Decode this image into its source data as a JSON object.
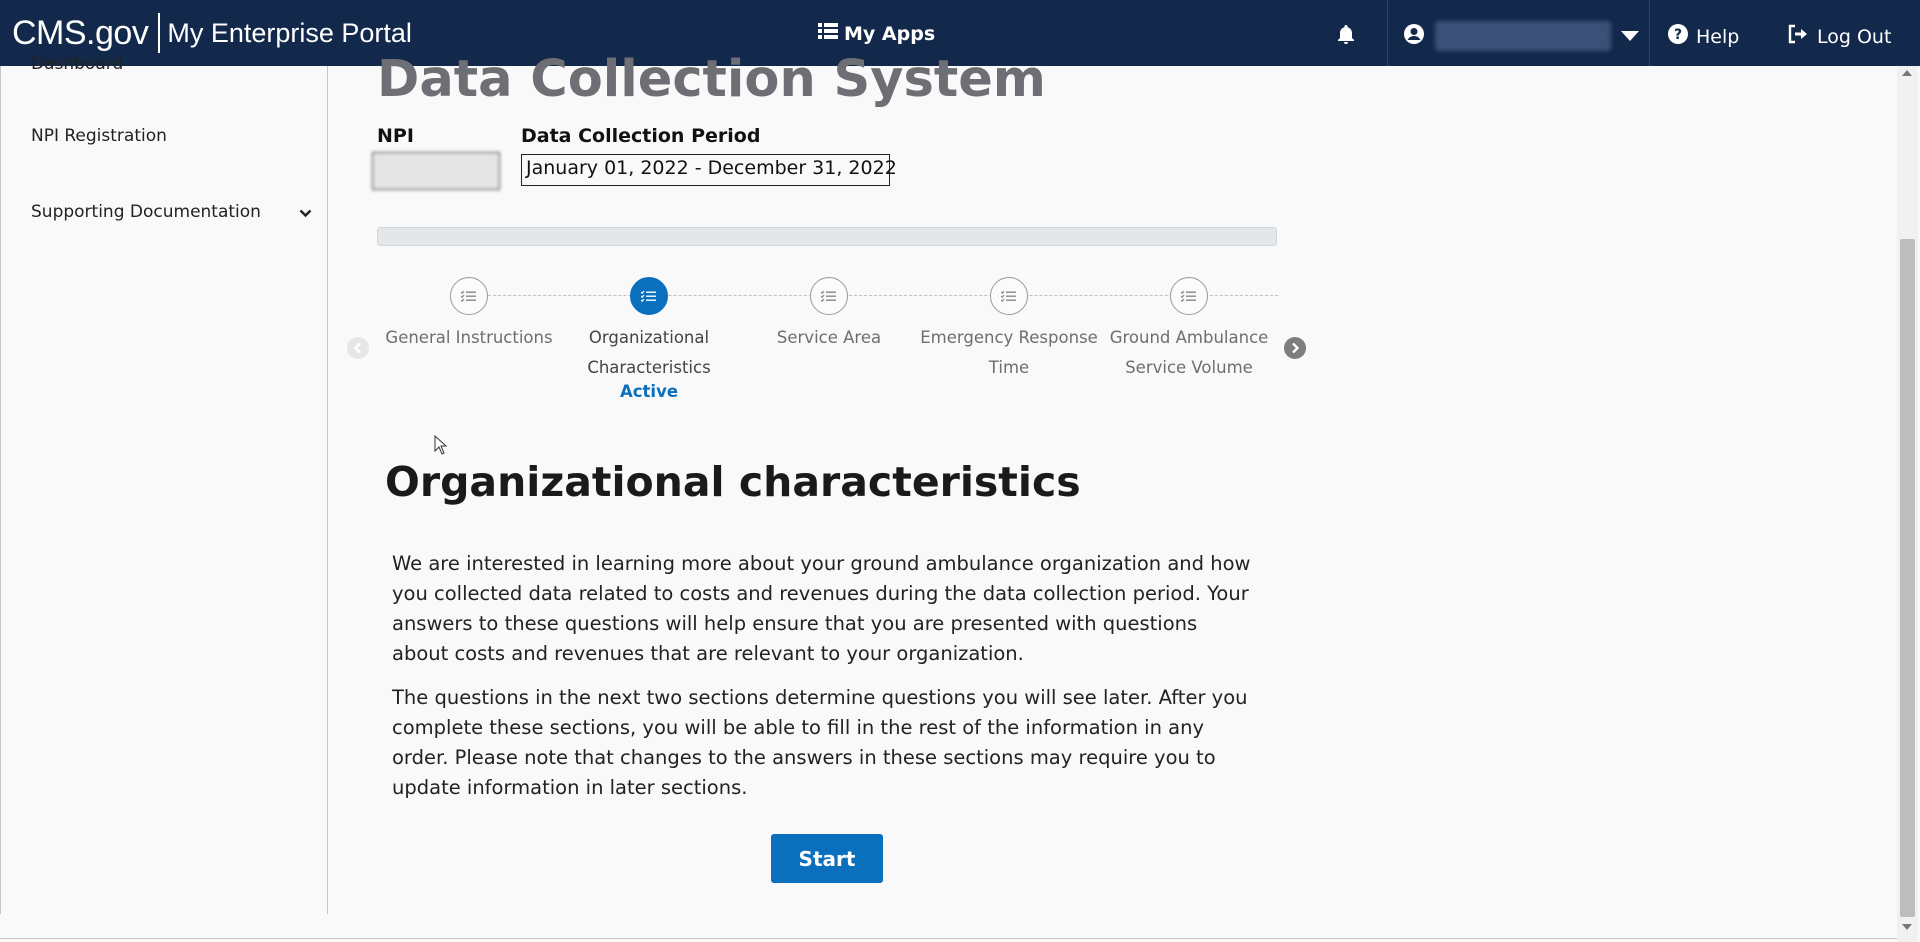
{
  "header": {
    "logo_cms": "CMS.gov",
    "logo_portal": "My Enterprise Portal",
    "my_apps_label": "My Apps",
    "help_label": "Help",
    "logout_label": "Log Out"
  },
  "sidebar": {
    "items": [
      {
        "label": "Dashboard"
      },
      {
        "label": "NPI Registration"
      },
      {
        "label": "Supporting Documentation"
      }
    ]
  },
  "main": {
    "page_title": "Data Collection System",
    "npi_label": "NPI",
    "period_label": "Data Collection Period",
    "period_value": "January 01, 2022 - December 31, 2022",
    "steps": [
      {
        "label": "General Instructions",
        "status": ""
      },
      {
        "label": "Organizational Characteristics",
        "status": "Active"
      },
      {
        "label": "Service Area",
        "status": ""
      },
      {
        "label": "Emergency Response Time",
        "status": ""
      },
      {
        "label": "Ground Ambulance Service Volume",
        "status": ""
      }
    ],
    "active_step": 1,
    "section_heading": "Organizational characteristics",
    "paragraph_1": "We are interested in learning more about your ground ambulance organization and how you collected data related to costs and revenues during the data collection period. Your answers to these questions will help ensure that you are presented with questions about costs and revenues that are relevant to your organization.",
    "paragraph_2": "The questions in the next two sections determine questions you will see later. After you complete these sections, you will be able to fill in the rest of the information in any order. Please note that changes to the answers in these sections may require you to update information in later sections.",
    "start_label": "Start"
  },
  "colors": {
    "header_bg": "#13294b",
    "accent": "#0a6fbd",
    "title_gray": "#6e6e75"
  }
}
